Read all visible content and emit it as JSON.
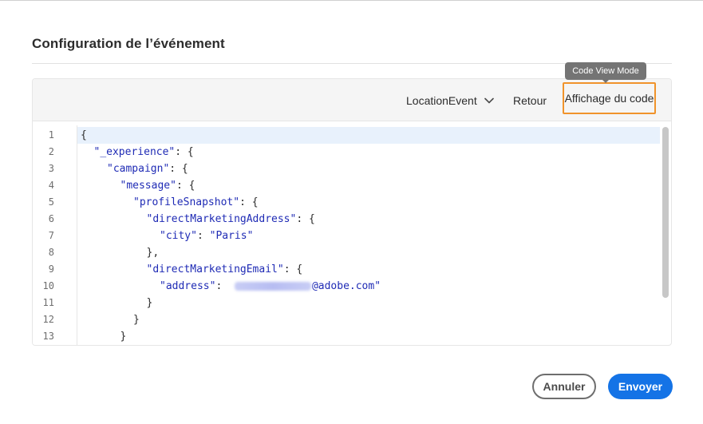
{
  "dialog": {
    "title": "Configuration de l’événement"
  },
  "toolbar": {
    "event_select": "LocationEvent",
    "back_label": "Retour",
    "code_view_label": "Affichage du code",
    "tooltip": "Code View Mode"
  },
  "editor": {
    "lines": [
      {
        "n": "1",
        "indent": 0,
        "parts": [
          {
            "t": "{"
          }
        ]
      },
      {
        "n": "2",
        "indent": 1,
        "parts": [
          {
            "t": "\"_experience\"",
            "c": "k"
          },
          {
            "t": ": {"
          }
        ]
      },
      {
        "n": "3",
        "indent": 2,
        "parts": [
          {
            "t": "\"campaign\"",
            "c": "k"
          },
          {
            "t": ": {"
          }
        ]
      },
      {
        "n": "4",
        "indent": 3,
        "parts": [
          {
            "t": "\"message\"",
            "c": "k"
          },
          {
            "t": ": {"
          }
        ]
      },
      {
        "n": "5",
        "indent": 4,
        "parts": [
          {
            "t": "\"profileSnapshot\"",
            "c": "k"
          },
          {
            "t": ": {"
          }
        ]
      },
      {
        "n": "6",
        "indent": 5,
        "parts": [
          {
            "t": "\"directMarketingAddress\"",
            "c": "k"
          },
          {
            "t": ": {"
          }
        ]
      },
      {
        "n": "7",
        "indent": 6,
        "parts": [
          {
            "t": "\"city\"",
            "c": "k"
          },
          {
            "t": ": "
          },
          {
            "t": "\"Paris\"",
            "c": "s"
          }
        ]
      },
      {
        "n": "8",
        "indent": 5,
        "parts": [
          {
            "t": "},"
          }
        ]
      },
      {
        "n": "9",
        "indent": 5,
        "parts": [
          {
            "t": "\"directMarketingEmail\"",
            "c": "k"
          },
          {
            "t": ": {"
          }
        ]
      },
      {
        "n": "10",
        "indent": 6,
        "parts": [
          {
            "t": "\"address\"",
            "c": "k"
          },
          {
            "t": ":  "
          },
          {
            "t": "",
            "c": "blur"
          },
          {
            "t": "@adobe.com\"",
            "c": "s"
          }
        ]
      },
      {
        "n": "11",
        "indent": 5,
        "parts": [
          {
            "t": "}"
          }
        ]
      },
      {
        "n": "12",
        "indent": 4,
        "parts": [
          {
            "t": "}"
          }
        ]
      },
      {
        "n": "13",
        "indent": 3,
        "parts": [
          {
            "t": "}"
          }
        ]
      }
    ]
  },
  "footer": {
    "cancel_label": "Annuler",
    "send_label": "Envoyer"
  },
  "colors": {
    "accent": "#1473e6",
    "highlight_border": "#f0932b",
    "code_key": "#1f2bb5"
  }
}
